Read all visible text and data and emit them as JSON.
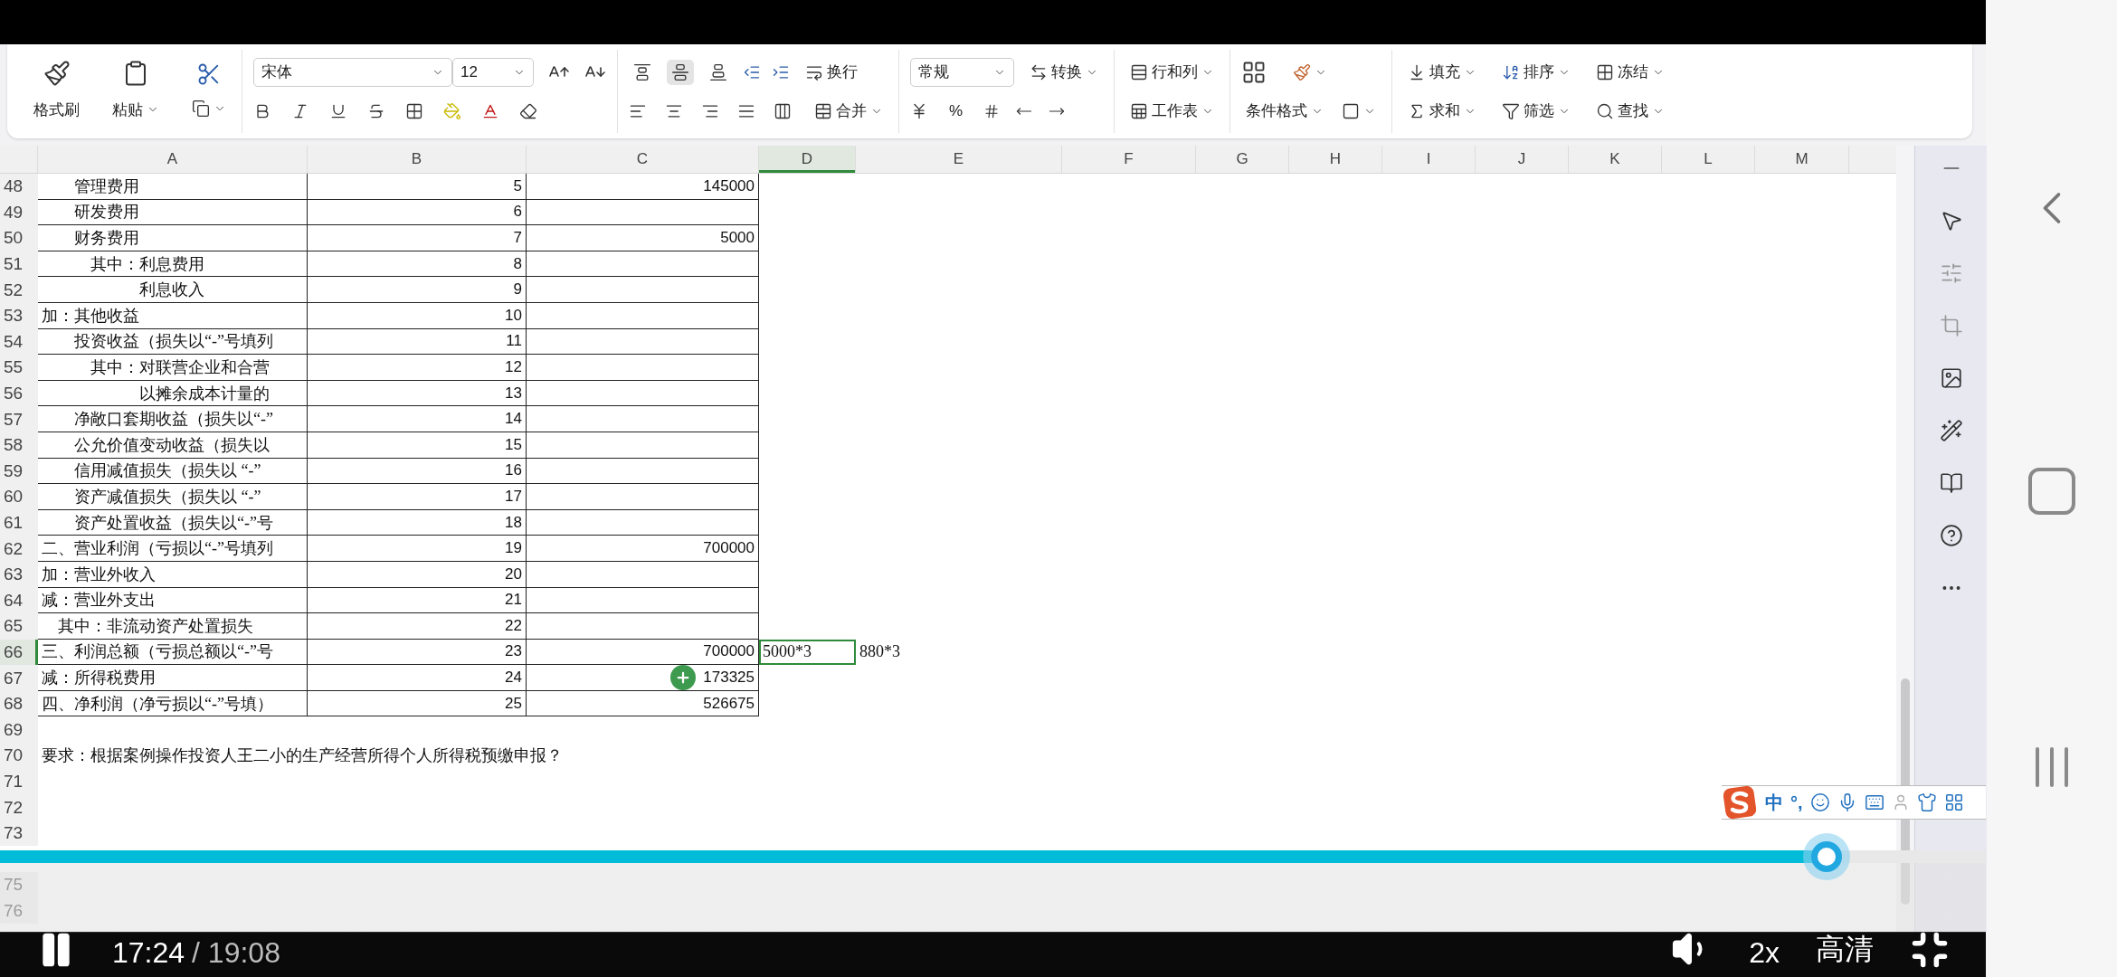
{
  "ribbon": {
    "clipboard": [
      {
        "label": "格式刷"
      },
      {
        "label": "粘贴"
      }
    ],
    "font": {
      "name": "宋体",
      "size": "12"
    },
    "alignment": {
      "vertical": [
        {
          "selected": false
        },
        {
          "selected": true
        },
        {
          "selected": false
        }
      ],
      "wrap": "换行",
      "merge": "合并"
    },
    "number": {
      "format": "常规",
      "convert": "转换",
      "percent": "%"
    },
    "cells": {
      "rows_cols": "行和列",
      "worksheet": "工作表"
    },
    "styles": {
      "conditional": "条件格式"
    },
    "editing": [
      {
        "label": "填充"
      },
      {
        "label": "排序"
      },
      {
        "label": "冻结"
      },
      {
        "label": "求和"
      },
      {
        "label": "筛选"
      },
      {
        "label": "查找"
      }
    ]
  },
  "sheet": {
    "columns": [
      {
        "label": "A",
        "selected": false
      },
      {
        "label": "B",
        "selected": false
      },
      {
        "label": "C",
        "selected": false
      },
      {
        "label": "D",
        "selected": true
      },
      {
        "label": "E",
        "selected": false
      },
      {
        "label": "F",
        "selected": false
      },
      {
        "label": "G",
        "selected": false
      },
      {
        "label": "H",
        "selected": false
      },
      {
        "label": "I",
        "selected": false
      },
      {
        "label": "J",
        "selected": false
      },
      {
        "label": "K",
        "selected": false
      },
      {
        "label": "L",
        "selected": false
      },
      {
        "label": "M",
        "selected": false
      }
    ],
    "rows": [
      {
        "number": "48",
        "kind": "table",
        "selected": false,
        "cells": [
          "　　管理费用",
          "5",
          "145000"
        ]
      },
      {
        "number": "49",
        "kind": "table",
        "selected": false,
        "cells": [
          "　　研发费用",
          "6"
        ]
      },
      {
        "number": "50",
        "kind": "table",
        "selected": false,
        "cells": [
          "　　财务费用",
          "7",
          "5000"
        ]
      },
      {
        "number": "51",
        "kind": "table",
        "selected": false,
        "cells": [
          "　　　其中：利息费用",
          "8"
        ]
      },
      {
        "number": "52",
        "kind": "table",
        "selected": false,
        "cells": [
          "　　　　　　利息收入",
          "9"
        ]
      },
      {
        "number": "53",
        "kind": "table",
        "selected": false,
        "cells": [
          "加：其他收益",
          "10"
        ]
      },
      {
        "number": "54",
        "kind": "table",
        "selected": false,
        "cells": [
          "　　投资收益（损失以“-”号填列",
          "11"
        ]
      },
      {
        "number": "55",
        "kind": "table",
        "selected": false,
        "cells": [
          "　　　其中：对联营企业和合营",
          "12"
        ]
      },
      {
        "number": "56",
        "kind": "table",
        "selected": false,
        "cells": [
          "　　　　　　以摊余成本计量的",
          "13"
        ]
      },
      {
        "number": "57",
        "kind": "table",
        "selected": false,
        "cells": [
          "　　净敞口套期收益（损失以“-”",
          "14"
        ]
      },
      {
        "number": "58",
        "kind": "table",
        "selected": false,
        "cells": [
          "　　公允价值变动收益（损失以",
          "15"
        ]
      },
      {
        "number": "59",
        "kind": "table",
        "selected": false,
        "cells": [
          "　　信用减值损失（损失以 “-”",
          "16"
        ]
      },
      {
        "number": "60",
        "kind": "table",
        "selected": false,
        "cells": [
          "　　资产减值损失（损失以 “-”",
          "17"
        ]
      },
      {
        "number": "61",
        "kind": "table",
        "selected": false,
        "cells": [
          "　　资产处置收益（损失以“-”号",
          "18"
        ]
      },
      {
        "number": "62",
        "kind": "table",
        "selected": false,
        "cells": [
          "二、营业利润（亏损以“-”号填列",
          "19",
          "700000"
        ]
      },
      {
        "number": "63",
        "kind": "table",
        "selected": false,
        "cells": [
          "加：营业外收入",
          "20"
        ]
      },
      {
        "number": "64",
        "kind": "table",
        "selected": false,
        "cells": [
          "减：营业外支出",
          "21"
        ]
      },
      {
        "number": "65",
        "kind": "table",
        "selected": false,
        "cells": [
          "　其中：非流动资产处置损失",
          "22"
        ]
      },
      {
        "number": "66",
        "kind": "table",
        "selected": true,
        "cells": [
          "三、利润总额（亏损总额以“-”号",
          "23",
          "700000",
          "5000*3",
          "880*3"
        ]
      },
      {
        "number": "67",
        "kind": "table",
        "selected": false,
        "pointer": true,
        "cells": [
          "减：所得税费用",
          "24",
          "173325"
        ]
      },
      {
        "number": "68",
        "kind": "table",
        "selected": false,
        "cells": [
          "四、净利润（净亏损以“-”号填）",
          "25",
          "526675"
        ]
      },
      {
        "number": "69",
        "kind": "blank",
        "selected": false
      },
      {
        "number": "70",
        "kind": "note",
        "selected": false,
        "cells": [
          "要求：根据案例操作投资人王二小的生产经营所得个人所得税预缴申报？"
        ]
      },
      {
        "number": "71",
        "kind": "blank",
        "selected": false
      },
      {
        "number": "72",
        "kind": "blank",
        "selected": false
      },
      {
        "number": "73",
        "kind": "blank",
        "selected": false
      },
      {
        "kind": "blank"
      },
      {
        "number": "75",
        "kind": "blank",
        "selected": false
      },
      {
        "number": "76",
        "kind": "blank",
        "selected": false
      }
    ]
  },
  "ime": {
    "mode": "中",
    "punctuation": "°,"
  },
  "video": {
    "playing": true,
    "elapsed": "17:24",
    "duration": "/ 19:08",
    "progress": {
      "level": 0.92
    },
    "speed": "2x",
    "quality": "高清"
  }
}
